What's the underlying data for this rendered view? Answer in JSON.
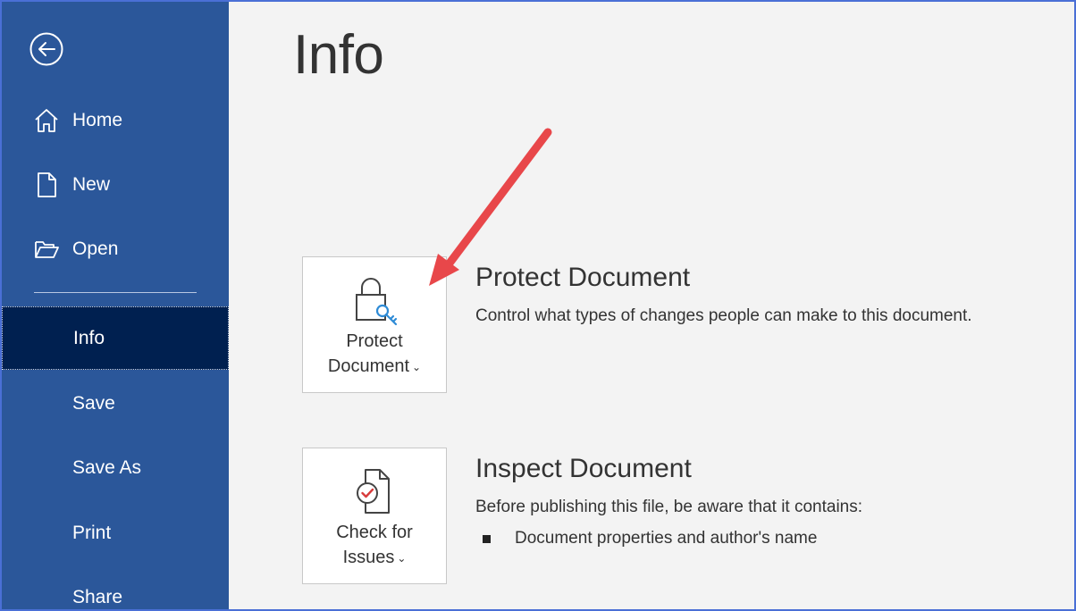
{
  "sidebar": {
    "items": [
      {
        "label": "Home",
        "icon": "home-icon"
      },
      {
        "label": "New",
        "icon": "new-document-icon"
      },
      {
        "label": "Open",
        "icon": "folder-open-icon"
      },
      {
        "label": "Info"
      },
      {
        "label": "Save"
      },
      {
        "label": "Save As"
      },
      {
        "label": "Print"
      },
      {
        "label": "Share"
      }
    ],
    "active": "Info"
  },
  "main": {
    "title": "Info",
    "protect": {
      "tile_line1": "Protect",
      "tile_line2": "Document",
      "heading": "Protect Document",
      "description": "Control what types of changes people can make to this document."
    },
    "inspect": {
      "tile_line1": "Check for",
      "tile_line2": "Issues",
      "heading": "Inspect Document",
      "description": "Before publishing this file, be aware that it contains:",
      "bullets": [
        "Document properties and author's name"
      ]
    }
  },
  "colors": {
    "sidebar_bg": "#2b579a",
    "active_bg": "#002050",
    "annotation_arrow": "#e8474a",
    "key_icon": "#2e8bd6",
    "check_icon": "#d83b3b"
  }
}
